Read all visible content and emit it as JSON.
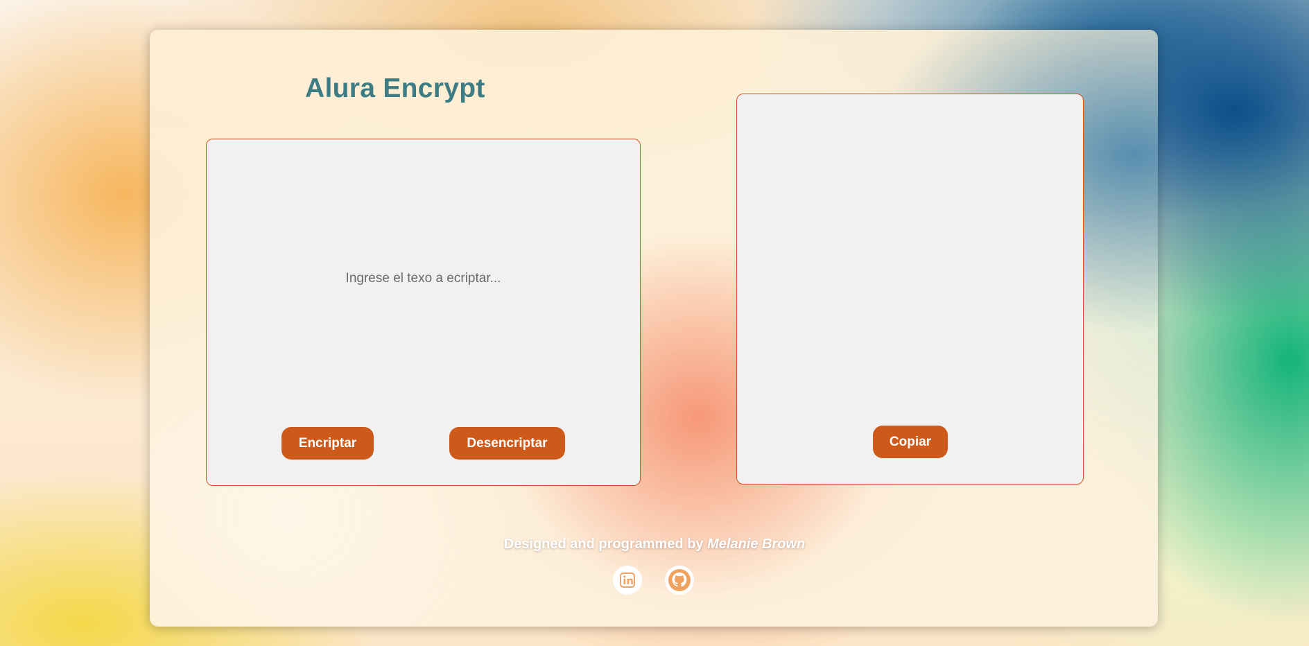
{
  "app": {
    "title": "Alura Encrypt"
  },
  "encrypt_panel": {
    "placeholder": "Ingrese el texo a ecriptar...",
    "encrypt_label": "Encriptar",
    "decrypt_label": "Desencriptar"
  },
  "output_panel": {
    "copy_label": "Copiar"
  },
  "footer": {
    "prefix": "Designed and programmed by",
    "author": "Melanie Brown",
    "icons": [
      "linkedin-icon",
      "github-icon"
    ]
  },
  "colors": {
    "accent": "#cd5a1a",
    "title": "#3d7c82",
    "panel_bg": "#f1f1f1",
    "panel_border": "#d0531f"
  }
}
